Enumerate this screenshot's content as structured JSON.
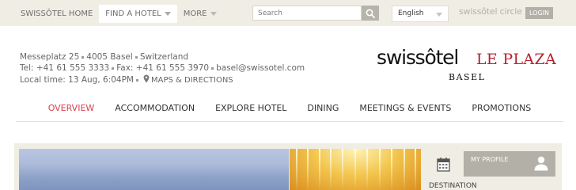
{
  "topbar": {
    "nav": [
      {
        "label": "SWISSÔTEL HOME"
      },
      {
        "label": "FIND A HOTEL"
      },
      {
        "label": "MORE"
      }
    ],
    "search_placeholder": "Search",
    "language": "English",
    "circle_label": "swissôtel circle",
    "login_label": "LOGIN"
  },
  "hotel": {
    "address": {
      "street": "Messeplatz 25",
      "postcode_city": "4005 Basel",
      "country": "Switzerland"
    },
    "tel": "Tel: +41 61 555 3333",
    "fax": "Fax: +41 61 555 3970",
    "email": "basel@swissotel.com",
    "local_time": "Local time: 13 Aug, 6:04PM",
    "map_link": "MAPS & DIRECTIONS",
    "logo": {
      "brand": "swissôtel",
      "hotel_name": "LE PLAZA",
      "city": "BASEL"
    }
  },
  "mainnav": [
    {
      "label": "OVERVIEW"
    },
    {
      "label": "ACCOMMODATION"
    },
    {
      "label": "EXPLORE HOTEL"
    },
    {
      "label": "DINING"
    },
    {
      "label": "MEETINGS & EVENTS"
    },
    {
      "label": "PROMOTIONS"
    }
  ],
  "side_panel": {
    "profile_label": "MY PROFILE",
    "destination_label": "DESTINATION"
  },
  "colors": {
    "accent": "#d9404f",
    "brand_red": "#b5202e",
    "topbar_bg": "#f0ede4",
    "button_gray": "#b3b0a7"
  },
  "icons": [
    "search-icon",
    "map-pin-icon",
    "calendar-icon",
    "person-icon",
    "chevron-down-icon"
  ]
}
